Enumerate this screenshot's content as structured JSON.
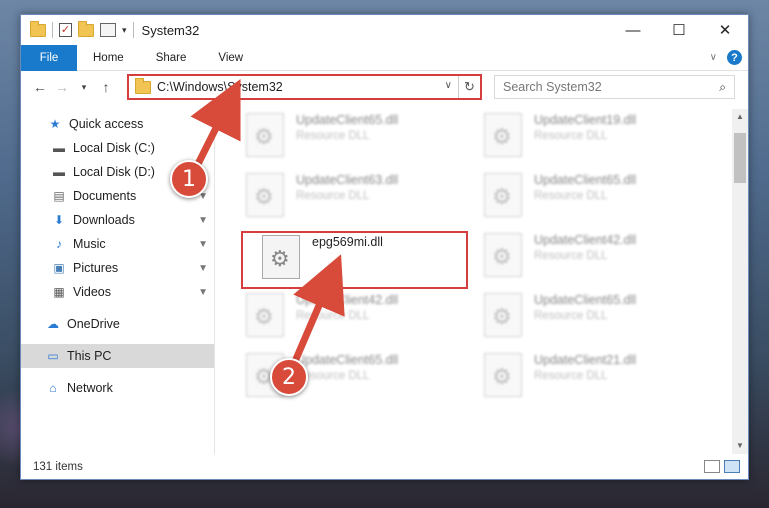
{
  "titlebar": {
    "title": "System32",
    "qat_caret": "▾",
    "min": "—",
    "max": "☐",
    "close": "✕"
  },
  "ribbon": {
    "tabs": [
      "File",
      "Home",
      "Share",
      "View"
    ],
    "expand": "∨",
    "help": "?"
  },
  "nav": {
    "back": "←",
    "forward": "→",
    "recent": "▾",
    "up": "↑"
  },
  "address": {
    "path": "C:\\Windows\\System32",
    "dropdown": "∨",
    "refresh": "↻"
  },
  "search": {
    "placeholder": "Search System32",
    "icon": "⌕"
  },
  "sidebar": {
    "items": [
      {
        "label": "Quick access",
        "icon": "★"
      },
      {
        "label": "Local Disk (C:)",
        "icon": "▬"
      },
      {
        "label": "Local Disk (D:)",
        "icon": "▬"
      },
      {
        "label": "Documents",
        "icon": "▤"
      },
      {
        "label": "Downloads",
        "icon": "⬇"
      },
      {
        "label": "Music",
        "icon": "♪"
      },
      {
        "label": "Pictures",
        "icon": "▣"
      },
      {
        "label": "Videos",
        "icon": "▦"
      },
      {
        "label": "OneDrive",
        "icon": "☁"
      },
      {
        "label": "This PC",
        "icon": "▭"
      },
      {
        "label": "Network",
        "icon": "⌂"
      }
    ],
    "pin": "📌"
  },
  "files": [
    {
      "name": "UpdateClient65.dll",
      "type": "Resource DLL"
    },
    {
      "name": "UpdateClient19.dll",
      "type": "Resource DLL"
    },
    {
      "name": "UpdateClient63.dll",
      "type": "Resource DLL"
    },
    {
      "name": "UpdateClient65.dll",
      "type": "Resource DLL"
    },
    {
      "name": "epg569mi.dll",
      "type": ""
    },
    {
      "name": "UpdateClient42.dll",
      "type": "Resource DLL"
    },
    {
      "name": "UpdateClient42.dll",
      "type": "Resource DLL"
    },
    {
      "name": "UpdateClient65.dll",
      "type": "Resource DLL"
    },
    {
      "name": "UpdateClient65.dll",
      "type": "Resource DLL"
    },
    {
      "name": "UpdateClient21.dll",
      "type": "Resource DLL"
    }
  ],
  "status": {
    "count": "131 items"
  },
  "annotations": {
    "marker1": "1",
    "marker2": "2",
    "color": "#d63d3d"
  }
}
